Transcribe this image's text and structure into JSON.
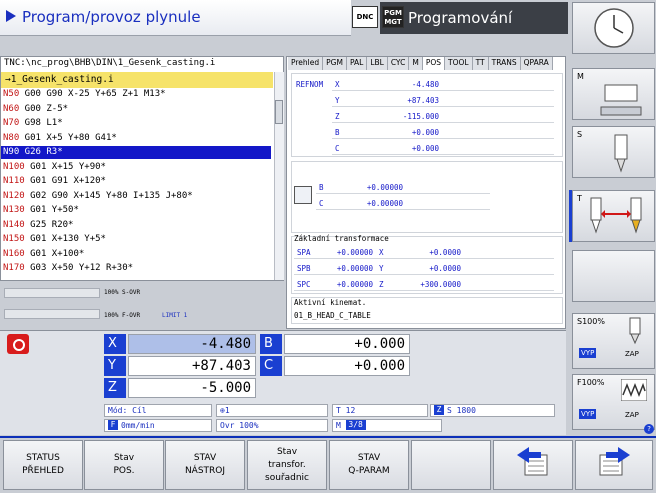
{
  "header": {
    "left_title": "Program/provoz plynule",
    "dnc_badge": "DNC",
    "pgm_badge": "PGM MGT",
    "right_title": "Programování"
  },
  "program": {
    "path": "TNC:\\nc_prog\\BHB\\DIN\\1_Gesenk_casting.i",
    "file": "→1_Gesenk_casting.i",
    "lines": [
      {
        "n": "N50",
        "code": " G00 G90 X-25 Y+65 Z+1 M13*"
      },
      {
        "n": "N60",
        "code": " G00 Z-5*"
      },
      {
        "n": "N70",
        "code": " G98 L1*"
      },
      {
        "n": "N80",
        "code": " G01 X+5 Y+80 G41*"
      },
      {
        "n": "N90",
        "code": " G26 R3*"
      },
      {
        "n": "N100",
        "code": " G01 X+15 Y+90*"
      },
      {
        "n": "N110",
        "code": " G01 G91 X+120*"
      },
      {
        "n": "N120",
        "code": " G02 G90 X+145 Y+80 I+135 J+80*"
      },
      {
        "n": "N130",
        "code": " G01 Y+50*"
      },
      {
        "n": "N140",
        "code": " G25 R20*"
      },
      {
        "n": "N150",
        "code": " G01 X+130 Y+5*"
      },
      {
        "n": "N160",
        "code": " G01 X+100*"
      },
      {
        "n": "N170",
        "code": " G03 X+50 Y+12 R+30*"
      }
    ],
    "selected_line": 4,
    "s_ovr": "100% S-OVR",
    "f_ovr": "100% F-OVR",
    "limit": "LIMIT 1"
  },
  "status": {
    "tabs": [
      "Prehled",
      "PGM",
      "PAL",
      "LBL",
      "CYC",
      "M",
      "POS",
      "TOOL",
      "TT",
      "TRANS",
      "QPARA"
    ],
    "active_tab": "POS",
    "refnom_label": "REFNOM",
    "refnom": [
      {
        "axis": "X",
        "value": "-4.480"
      },
      {
        "axis": "Y",
        "value": "+87.403"
      },
      {
        "axis": "Z",
        "value": "-115.000"
      },
      {
        "axis": "B",
        "value": "+0.000"
      },
      {
        "axis": "C",
        "value": "+0.000"
      }
    ],
    "rot": [
      {
        "axis": "B",
        "value": "+0.00000"
      },
      {
        "axis": "C",
        "value": "+0.00000"
      }
    ],
    "basic_transform_title": "Základní transformace",
    "transforms": [
      {
        "a1": "SPA",
        "v1": "+0.00000",
        "a2": "X",
        "v2": "+0.0000"
      },
      {
        "a1": "SPB",
        "v1": "+0.00000",
        "a2": "Y",
        "v2": "+0.0000"
      },
      {
        "a1": "SPC",
        "v1": "+0.00000",
        "a2": "Z",
        "v2": "+300.0000"
      }
    ],
    "kinematics_title": "Aktivní kinemat.",
    "kinematics": "01_B_HEAD_C_TABLE"
  },
  "position": {
    "axes": [
      {
        "axis": "X",
        "value": "-4.480"
      },
      {
        "axis": "Y",
        "value": "+87.403"
      },
      {
        "axis": "Z",
        "value": "-5.000"
      }
    ],
    "axes2": [
      {
        "axis": "B",
        "value": "+0.000"
      },
      {
        "axis": "C",
        "value": "+0.000"
      }
    ],
    "mode": "Mód: Cíl",
    "tool_num": "1",
    "tool": "T 12",
    "spindle_z": "Z",
    "spindle": "S 1800",
    "feed_f": "F",
    "feed": "0mm/min",
    "ovr": "Ovr 100%",
    "m_label": "M",
    "m_value": "3/8"
  },
  "softkeys": [
    {
      "label": "STATUS\nPŘEHLED"
    },
    {
      "label": "Stav\nPOS."
    },
    {
      "label": "STAV\nNÁSTROJ"
    },
    {
      "label": "Stav\ntransfor.\nsouřadnic"
    },
    {
      "label": "STAV\nQ-PARAM"
    },
    {
      "label": ""
    },
    {
      "label": ""
    },
    {
      "label": ""
    }
  ],
  "vertical": {
    "m_label": "M",
    "s_label": "S",
    "t_label": "T",
    "s_override": "S100%",
    "f_override": "F100%",
    "vyp": "VYP",
    "zap": "ZAP",
    "help": "?"
  }
}
